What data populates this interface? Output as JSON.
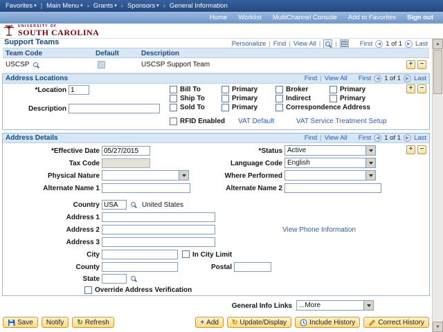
{
  "colors": {
    "garnet": "#73000a",
    "header_blue": "#2a5694",
    "panel_header": "#d6e6f5",
    "link": "#2b5cad",
    "button_gold": "#fbd56f"
  },
  "icons": {
    "caret": "▾",
    "crumb_sep": "›",
    "sep": "|",
    "prev": "◀",
    "next": "▶",
    "refresh": "↻",
    "update": "↻",
    "add": "+",
    "remove": "−",
    "scroll_up": "▲",
    "scroll_down": "▼"
  },
  "topnav": {
    "favorites": "Favorites",
    "main_menu": "Main Menu",
    "grants": "Grants",
    "sponsors": "Sponsors",
    "current": "General Information"
  },
  "userbar": {
    "home": "Home",
    "worklist": "Worklist",
    "multichannel": "MultiChannel Console",
    "add_to_favorites": "Add to Favorites",
    "sign_out": "Sign out"
  },
  "logo": {
    "line1": "UNIVERSITY OF",
    "line2": "SOUTH CAROLINA"
  },
  "toolbar": {
    "personalize": "Personalize",
    "find": "Find",
    "view_all": "View All"
  },
  "pager": {
    "first": "First",
    "pos": "1 of 1",
    "last": "Last"
  },
  "support_teams": {
    "title": "Support Teams",
    "columns": {
      "team_code": "Team Code",
      "default": "Default",
      "description": "Description"
    },
    "row": {
      "team_code": "USCSP",
      "description": "USCSP Support Team"
    }
  },
  "address_locations": {
    "title": "Address Locations",
    "location_label": "*Location",
    "location_value": "1",
    "description_label": "Description",
    "description_value": "",
    "cb": {
      "bill_to": "Bill To",
      "primary_a": "Primary",
      "broker": "Broker",
      "primary_d": "Primary",
      "ship_to": "Ship To",
      "primary_b": "Primary",
      "indirect": "Indirect",
      "primary_e": "Primary",
      "sold_to": "Sold To",
      "primary_c": "Primary",
      "correspondence": "Correspondence Address",
      "rfid": "RFID Enabled"
    },
    "vat_default": "VAT Default",
    "vat_service": "VAT Service Treatment Setup"
  },
  "address_details": {
    "title": "Address Details",
    "effective_date": {
      "label": "*Effective Date",
      "value": "05/27/2015"
    },
    "status": {
      "label": "*Status",
      "value": "Active"
    },
    "tax_code": {
      "label": "Tax Code",
      "value": ""
    },
    "language": {
      "label": "Language Code",
      "value": "English"
    },
    "physical_nature": {
      "label": "Physical Nature",
      "value": ""
    },
    "where_performed": {
      "label": "Where Performed",
      "value": ""
    },
    "alt_name1": {
      "label": "Alternate Name 1",
      "value": ""
    },
    "alt_name2": {
      "label": "Alternate Name 2",
      "value": ""
    },
    "country": {
      "label": "Country",
      "value": "USA",
      "display": "United States"
    },
    "address1": {
      "label": "Address 1",
      "value": ""
    },
    "address2": {
      "label": "Address 2",
      "value": ""
    },
    "address3": {
      "label": "Address 3",
      "value": ""
    },
    "view_phone": "View Phone Information",
    "city": {
      "label": "City",
      "value": ""
    },
    "in_city_limit": "In City Limit",
    "county": {
      "label": "County",
      "value": ""
    },
    "postal": {
      "label": "Postal",
      "value": ""
    },
    "state": {
      "label": "State",
      "value": ""
    },
    "override": "Override Address Verification"
  },
  "general_info": {
    "label": "General Info Links",
    "value": "...More"
  },
  "footer": {
    "save": "Save",
    "notify": "Notify",
    "refresh": "Refresh",
    "add": "Add",
    "update_display": "Update/Display",
    "include_history": "Include History",
    "correct_history": "Correct History"
  }
}
